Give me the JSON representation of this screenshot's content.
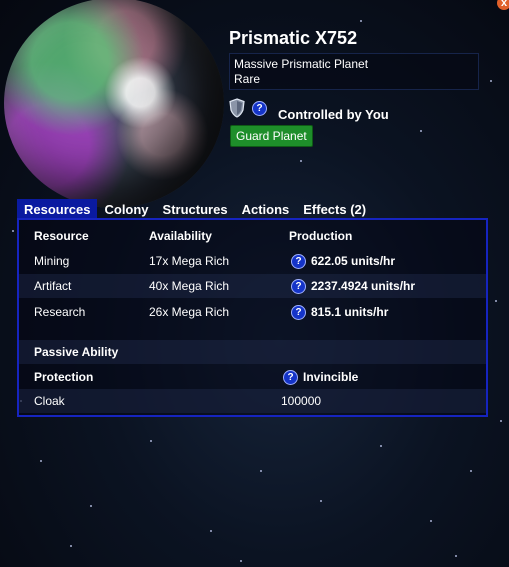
{
  "planet": {
    "name": "Prismatic X752",
    "description": "Massive Prismatic Planet",
    "rarity": "Rare",
    "control_status": "Controlled by You",
    "guard_button": "Guard Planet"
  },
  "icons": {
    "help": "?",
    "close": "x",
    "shield": "shield-icon"
  },
  "tabs": [
    {
      "label": "Resources",
      "active": true
    },
    {
      "label": "Colony"
    },
    {
      "label": "Structures"
    },
    {
      "label": "Actions"
    },
    {
      "label": "Effects (2)"
    }
  ],
  "table": {
    "headers": [
      "Resource",
      "Availability",
      "Production"
    ],
    "rows": [
      {
        "resource": "Mining",
        "availability": "17x Mega Rich",
        "production": "622.05 units/hr"
      },
      {
        "resource": "Artifact",
        "availability": "40x Mega Rich",
        "production": "2237.4924 units/hr"
      },
      {
        "resource": "Research",
        "availability": "26x Mega Rich",
        "production": "815.1 units/hr"
      }
    ]
  },
  "passive": {
    "title": "Passive Ability",
    "name": "Protection",
    "value": "Invincible",
    "stat_name": "Cloak",
    "stat_value": "100000"
  },
  "colors": {
    "tab_active": "#0a1aa0",
    "panel_border": "#1624c0",
    "guard_button": "#1e8e2a",
    "close_button": "#e0602a"
  }
}
